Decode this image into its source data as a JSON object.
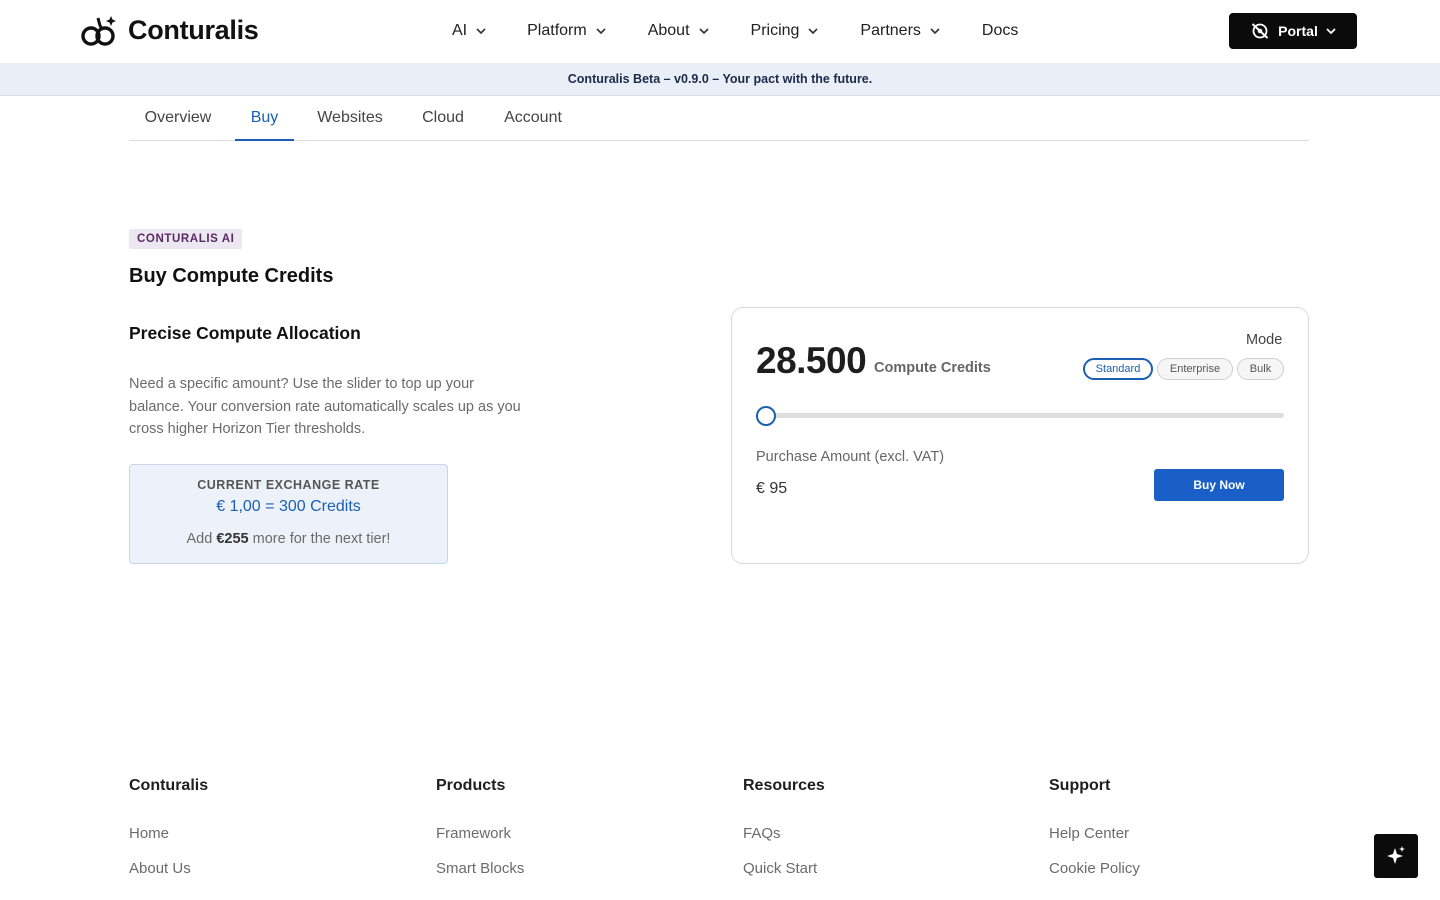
{
  "header": {
    "brand": "Conturalis",
    "nav": [
      {
        "label": "AI"
      },
      {
        "label": "Platform"
      },
      {
        "label": "About"
      },
      {
        "label": "Pricing"
      },
      {
        "label": "Partners"
      },
      {
        "label": "Docs"
      }
    ],
    "portal_label": "Portal"
  },
  "banner": {
    "text": "Conturalis Beta – v0.9.0 – Your pact with the future."
  },
  "tabs": [
    {
      "label": "Overview"
    },
    {
      "label": "Buy",
      "active": true
    },
    {
      "label": "Websites"
    },
    {
      "label": "Cloud"
    },
    {
      "label": "Account"
    }
  ],
  "intro": {
    "badge": "CONTURALIS AI",
    "title": "Buy Compute Credits",
    "subtitle": "Precise Compute Allocation",
    "description": "Need a specific amount? Use the slider to top up your balance. Your conversion rate automatically scales up as you cross higher Horizon Tier thresholds."
  },
  "exchange": {
    "label": "CURRENT EXCHANGE RATE",
    "rate": "€ 1,00 = 300 Credits",
    "next_prefix": "Add ",
    "next_amount": "€255",
    "next_suffix": " more for the next tier!"
  },
  "purchase": {
    "credits": "28.500",
    "credits_unit": "Compute Credits",
    "mode_label": "Mode",
    "modes": [
      {
        "label": "Standard",
        "active": true
      },
      {
        "label": "Enterprise"
      },
      {
        "label": "Bulk"
      }
    ],
    "slider_fraction": 0.0,
    "amount_label": "Purchase Amount (excl. VAT)",
    "amount_value": "€ 95",
    "buy_label": "Buy Now"
  },
  "footer": {
    "columns": [
      {
        "title": "Conturalis",
        "links": [
          "Home",
          "About Us"
        ]
      },
      {
        "title": "Products",
        "links": [
          "Framework",
          "Smart Blocks"
        ]
      },
      {
        "title": "Resources",
        "links": [
          "FAQs",
          "Quick Start"
        ]
      },
      {
        "title": "Support",
        "links": [
          "Help Center",
          "Cookie Policy"
        ]
      }
    ]
  },
  "colors": {
    "accent": "#1a5fb4",
    "button": "#1a5fc8",
    "banner_bg": "#e9eef7",
    "badge_bg": "#ece7f1",
    "badge_text": "#5a2a63"
  },
  "icons": {
    "logo": "infinity-sparkle-icon",
    "portal": "no-eye-icon",
    "fab": "sparkle-icon"
  }
}
